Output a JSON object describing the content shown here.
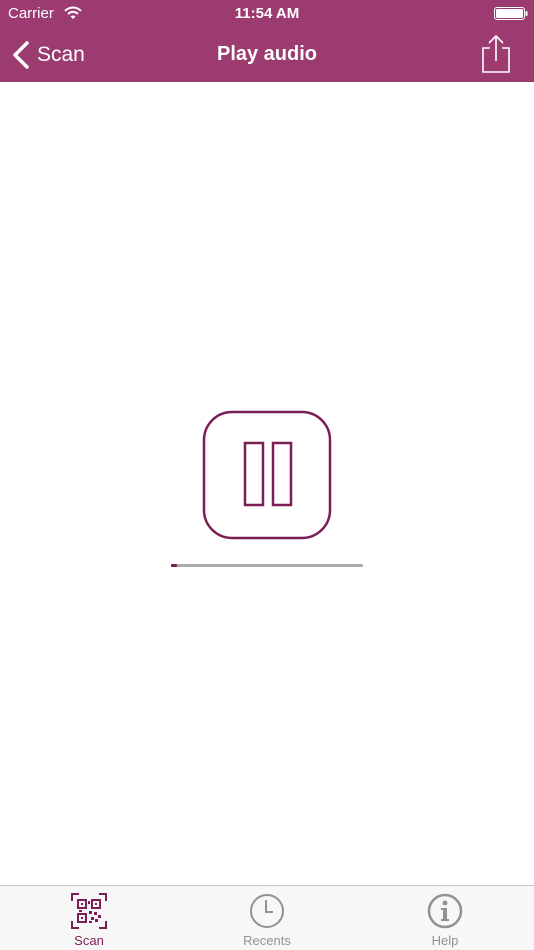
{
  "colors": {
    "header_bg": "#9b3b6f",
    "accent": "#7a1e55",
    "inactive": "#929292"
  },
  "status_bar": {
    "carrier": "Carrier",
    "time": "11:54 AM",
    "wifi_icon": "wifi-icon",
    "battery_icon": "battery-icon"
  },
  "nav": {
    "back_label": "Scan",
    "back_icon": "chevron-left-icon",
    "title": "Play audio",
    "share_icon": "share-icon"
  },
  "player": {
    "state": "playing",
    "control_icon": "pause-icon",
    "progress": 0.03
  },
  "tabs": [
    {
      "label": "Scan",
      "icon": "qr-code-icon",
      "active": true
    },
    {
      "label": "Recents",
      "icon": "clock-icon",
      "active": false
    },
    {
      "label": "Help",
      "icon": "info-icon",
      "active": false
    }
  ]
}
